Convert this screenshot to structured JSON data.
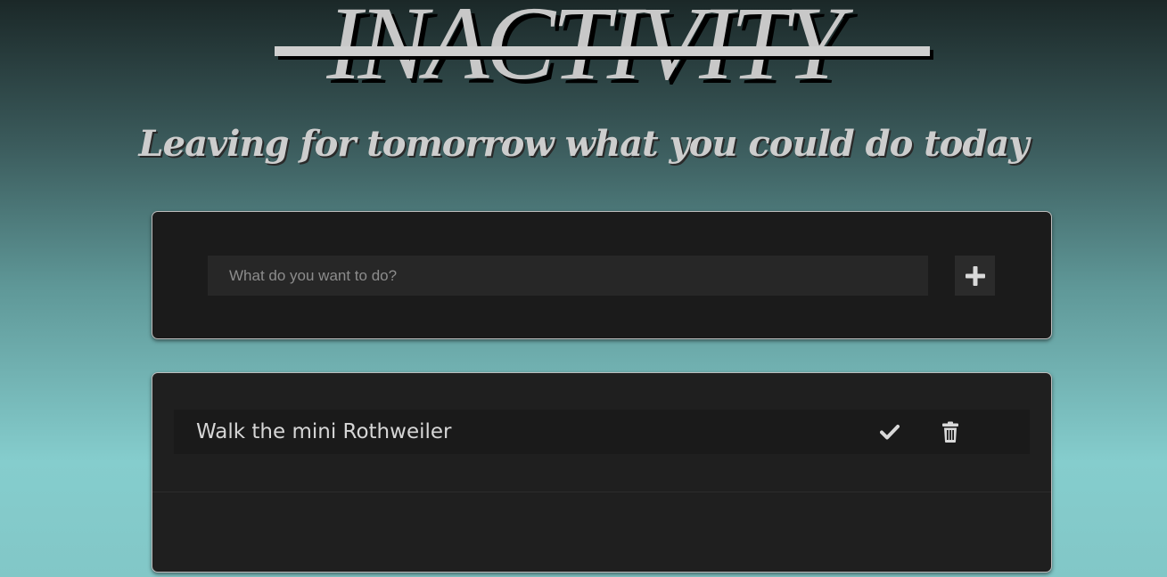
{
  "header": {
    "title": "INACTIVITY",
    "subtitle": "Leaving for tomorrow what you could do today"
  },
  "input_section": {
    "placeholder": "What do you want to do?",
    "value": "",
    "add_icon": "plus-icon"
  },
  "todos": [
    {
      "text": "Walk the mini Rothweiler",
      "complete_icon": "check-icon",
      "delete_icon": "trash-icon"
    }
  ],
  "colors": {
    "card_background": "#1b1b1b",
    "text": "#d6d6d6",
    "gradient_top": "#1b2828",
    "gradient_bottom": "#85cdcd"
  }
}
